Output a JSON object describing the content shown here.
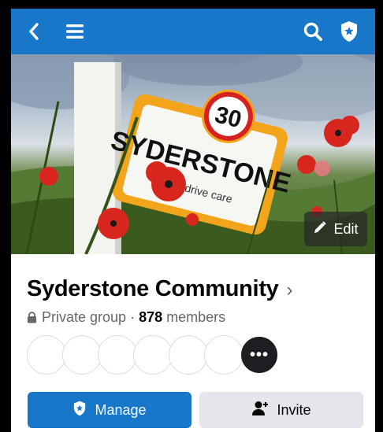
{
  "colors": {
    "brand": "#1877c9",
    "secondary_button": "#e4e6eb",
    "text_primary": "#050505",
    "text_secondary": "#65676b"
  },
  "topbar": {
    "back_icon": "chevron-left-icon",
    "menu_icon": "hamburger-menu-icon",
    "search_icon": "search-icon",
    "admin_icon": "admin-shield-star-icon"
  },
  "cover": {
    "sign_speed": "30",
    "sign_text": "SYDERSTONE",
    "sign_subtext": "se drive care",
    "edit_label": "Edit",
    "edit_icon": "pencil-icon"
  },
  "group": {
    "name": "Syderstone Community",
    "chevron": "›",
    "privacy": "Private group",
    "separator": "·",
    "member_count": "878",
    "members_label": "members"
  },
  "members_strip": {
    "more_label": "•••"
  },
  "actions": {
    "manage_label": "Manage",
    "invite_label": "Invite"
  }
}
